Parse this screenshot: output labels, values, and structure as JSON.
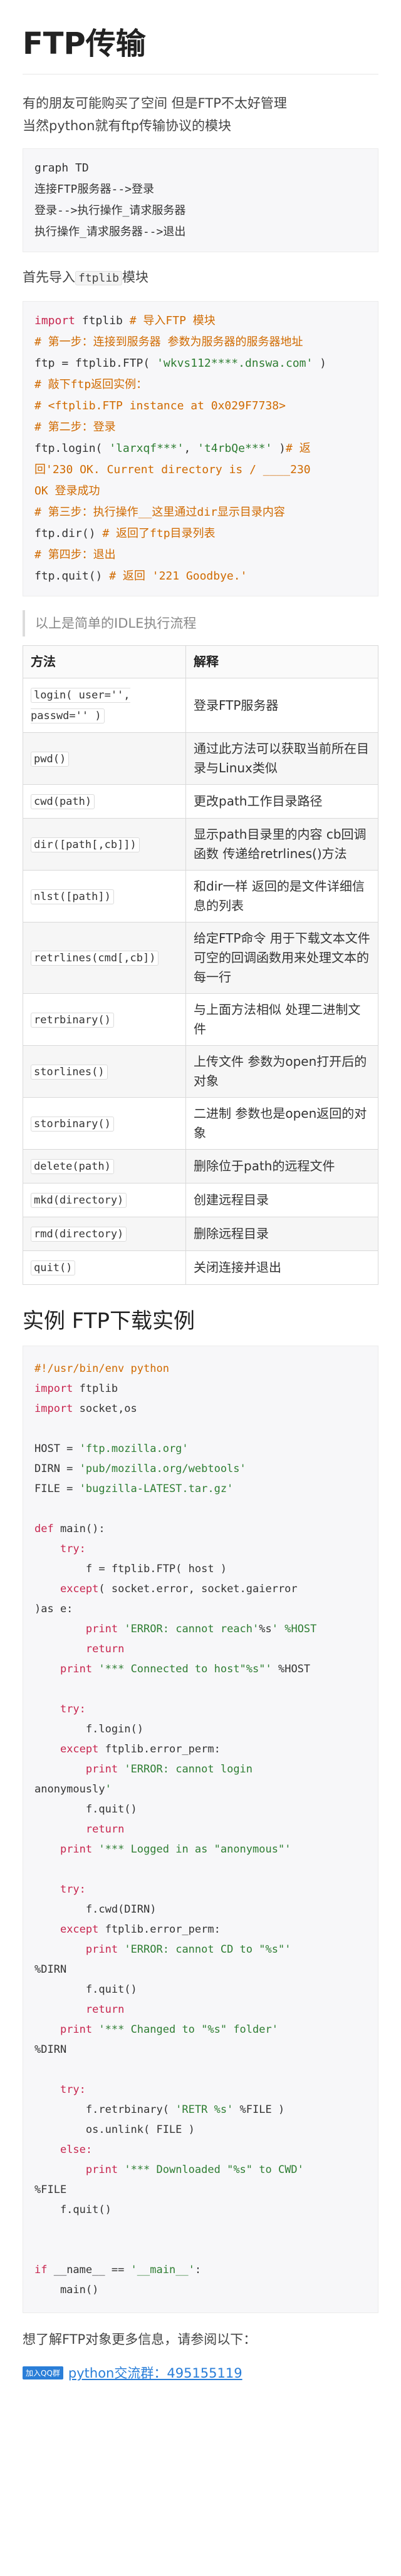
{
  "title": "FTP传输",
  "intro": [
    "有的朋友可能购买了空间   但是FTP不太好管理",
    "当然python就有ftp传输协议的模块"
  ],
  "graph_code": [
    "graph TD",
    "连接FTP服务器-->登录",
    "登录-->执行操作_请求服务器",
    "执行操作_请求服务器-->退出"
  ],
  "import_text_before": "首先导入",
  "import_text_code": "ftplib",
  "import_text_after": "模块",
  "code1": [
    {
      "parts": [
        {
          "t": "k",
          "v": "import"
        },
        {
          "t": "n",
          "v": " ftplib "
        },
        {
          "t": "c",
          "v": "# 导入FTP 模块"
        }
      ]
    },
    {
      "parts": [
        {
          "t": "c",
          "v": "# 第一步：连接到服务器 参数为服务器的服务器地址"
        }
      ]
    },
    {
      "parts": [
        {
          "t": "n",
          "v": "ftp = ftplib.FTP( "
        },
        {
          "t": "s",
          "v": "'wkvs112****.dnswa.com'"
        },
        {
          "t": "n",
          "v": " )"
        }
      ]
    },
    {
      "parts": [
        {
          "t": "c",
          "v": "# 敲下ftp返回实例："
        }
      ]
    },
    {
      "parts": [
        {
          "t": "c",
          "v": "# <ftplib.FTP instance at 0x029F7738>"
        }
      ]
    },
    {
      "parts": [
        {
          "t": "c",
          "v": "# 第二步：登录"
        }
      ]
    },
    {
      "parts": [
        {
          "t": "n",
          "v": "ftp.login( "
        },
        {
          "t": "s",
          "v": "'larxqf***'"
        },
        {
          "t": "n",
          "v": ", "
        },
        {
          "t": "s",
          "v": "'t4rbQe***'"
        },
        {
          "t": "n",
          "v": " )"
        },
        {
          "t": "c",
          "v": "# 返"
        }
      ]
    },
    {
      "parts": [
        {
          "t": "c",
          "v": "回'230 OK. Current directory is / ____230"
        }
      ]
    },
    {
      "parts": [
        {
          "t": "c",
          "v": "OK 登录成功"
        }
      ]
    },
    {
      "parts": [
        {
          "t": "c",
          "v": "# 第三步：执行操作__这里通过dir显示目录内容"
        }
      ]
    },
    {
      "parts": [
        {
          "t": "n",
          "v": "ftp.dir() "
        },
        {
          "t": "c",
          "v": "# 返回了ftp目录列表"
        }
      ]
    },
    {
      "parts": [
        {
          "t": "c",
          "v": "# 第四步：退出"
        }
      ]
    },
    {
      "parts": [
        {
          "t": "n",
          "v": "ftp.quit() "
        },
        {
          "t": "c",
          "v": "# 返回 '221 Goodbye.'"
        }
      ]
    }
  ],
  "quote": "以上是简单的IDLE执行流程",
  "table": {
    "headers": [
      "方法",
      "解释"
    ],
    "rows": [
      [
        "login( user='', passwd='' )",
        "登录FTP服务器"
      ],
      [
        "pwd()",
        "通过此方法可以获取当前所在目录与Linux类似"
      ],
      [
        "cwd(path)",
        "更改path工作目录路径"
      ],
      [
        "dir([path[,cb]])",
        "显示path目录里的内容 cb回调函数  传递给retrlines()方法"
      ],
      [
        "nlst([path])",
        "和dir一样 返回的是文件详细信息的列表"
      ],
      [
        "retrlines(cmd[,cb])",
        "给定FTP命令 用于下载文本文件  可空的回调函数用来处理文本的每一行"
      ],
      [
        "retrbinary()",
        "与上面方法相似   处理二进制文件"
      ],
      [
        "storlines()",
        "上传文件  参数为open打开后的对象"
      ],
      [
        "storbinary()",
        "二进制 参数也是open返回的对象"
      ],
      [
        "delete(path)",
        "删除位于path的远程文件"
      ],
      [
        "mkd(directory)",
        "创建远程目录"
      ],
      [
        "rmd(directory)",
        "删除远程目录"
      ],
      [
        "quit()",
        "关闭连接并退出"
      ]
    ]
  },
  "section_title": "实例 FTP下载实例",
  "code2": [
    "#!/usr/bin/env python",
    "import ftplib",
    "import socket,os",
    "",
    "HOST = 'ftp.mozilla.org'",
    "DIRN = 'pub/mozilla.org/webtools'",
    "FILE = 'bugzilla-LATEST.tar.gz'",
    "",
    "def main():",
    "    try:",
    "        f = ftplib.FTP( host )",
    "    except( socket.error, socket.gaierror",
    ")as e:",
    "        print 'ERROR: cannot reach'%s' %HOST",
    "        return",
    "    print '*** Connected to host\"%s\"' %HOST",
    "",
    "    try:",
    "        f.login()",
    "    except ftplib.error_perm:",
    "        print 'ERROR: cannot login",
    "anonymously'",
    "        f.quit()",
    "        return",
    "    print '*** Logged in as \"anonymous\"'",
    "",
    "    try:",
    "        f.cwd(DIRN)",
    "    except ftplib.error_perm:",
    "        print 'ERROR: cannot CD to \"%s\"'",
    "%DIRN",
    "        f.quit()",
    "        return",
    "    print '*** Changed to \"%s\" folder'",
    "%DIRN",
    "",
    "    try:",
    "        f.retrbinary( 'RETR %s' %FILE )",
    "        os.unlink( FILE )",
    "    else:",
    "        print '*** Downloaded \"%s\" to CWD'",
    "%FILE",
    "    f.quit()",
    "",
    "",
    "if __name__ == '__main__':",
    "    main()"
  ],
  "footer_text": "想了解FTP对象更多信息，请参阅以下：",
  "qq_badge": "加入QQ群",
  "qq_link": "python交流群：495155119"
}
